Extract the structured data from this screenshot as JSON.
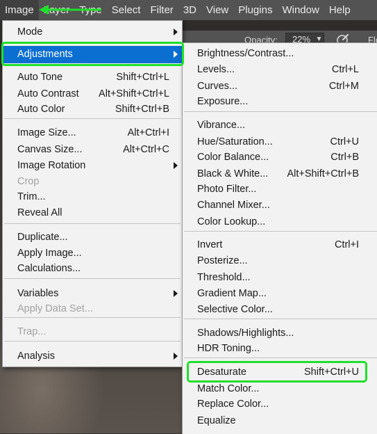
{
  "menubar": {
    "items": [
      "Image",
      "Layer",
      "Type",
      "Select",
      "Filter",
      "3D",
      "View",
      "Plugins",
      "Window",
      "Help"
    ],
    "active_index": 0
  },
  "options_bar": {
    "opacity_label": "Opacity:",
    "opacity_value": "22%",
    "flow_label": "Flo"
  },
  "image_menu": {
    "items": [
      {
        "label": "Mode",
        "shortcut": "",
        "submenu": true,
        "disabled": false
      },
      {
        "label": "Adjustments",
        "shortcut": "",
        "submenu": true,
        "disabled": false,
        "selected": true
      },
      {
        "label": "Auto Tone",
        "shortcut": "Shift+Ctrl+L",
        "submenu": false,
        "disabled": false
      },
      {
        "label": "Auto Contrast",
        "shortcut": "Alt+Shift+Ctrl+L",
        "submenu": false,
        "disabled": false
      },
      {
        "label": "Auto Color",
        "shortcut": "Shift+Ctrl+B",
        "submenu": false,
        "disabled": false
      },
      {
        "label": "Image Size...",
        "shortcut": "Alt+Ctrl+I",
        "submenu": false,
        "disabled": false
      },
      {
        "label": "Canvas Size...",
        "shortcut": "Alt+Ctrl+C",
        "submenu": false,
        "disabled": false
      },
      {
        "label": "Image Rotation",
        "shortcut": "",
        "submenu": true,
        "disabled": false
      },
      {
        "label": "Crop",
        "shortcut": "",
        "submenu": false,
        "disabled": true
      },
      {
        "label": "Trim...",
        "shortcut": "",
        "submenu": false,
        "disabled": false
      },
      {
        "label": "Reveal All",
        "shortcut": "",
        "submenu": false,
        "disabled": false
      },
      {
        "label": "Duplicate...",
        "shortcut": "",
        "submenu": false,
        "disabled": false
      },
      {
        "label": "Apply Image...",
        "shortcut": "",
        "submenu": false,
        "disabled": false
      },
      {
        "label": "Calculations...",
        "shortcut": "",
        "submenu": false,
        "disabled": false
      },
      {
        "label": "Variables",
        "shortcut": "",
        "submenu": true,
        "disabled": false
      },
      {
        "label": "Apply Data Set...",
        "shortcut": "",
        "submenu": false,
        "disabled": true
      },
      {
        "label": "Trap...",
        "shortcut": "",
        "submenu": false,
        "disabled": true
      },
      {
        "label": "Analysis",
        "shortcut": "",
        "submenu": true,
        "disabled": false
      }
    ]
  },
  "adjustments_menu": {
    "items": [
      {
        "label": "Brightness/Contrast...",
        "shortcut": ""
      },
      {
        "label": "Levels...",
        "shortcut": "Ctrl+L"
      },
      {
        "label": "Curves...",
        "shortcut": "Ctrl+M"
      },
      {
        "label": "Exposure...",
        "shortcut": ""
      },
      {
        "label": "Vibrance...",
        "shortcut": ""
      },
      {
        "label": "Hue/Saturation...",
        "shortcut": "Ctrl+U"
      },
      {
        "label": "Color Balance...",
        "shortcut": "Ctrl+B"
      },
      {
        "label": "Black & White...",
        "shortcut": "Alt+Shift+Ctrl+B"
      },
      {
        "label": "Photo Filter...",
        "shortcut": ""
      },
      {
        "label": "Channel Mixer...",
        "shortcut": ""
      },
      {
        "label": "Color Lookup...",
        "shortcut": ""
      },
      {
        "label": "Invert",
        "shortcut": "Ctrl+I"
      },
      {
        "label": "Posterize...",
        "shortcut": ""
      },
      {
        "label": "Threshold...",
        "shortcut": ""
      },
      {
        "label": "Gradient Map...",
        "shortcut": ""
      },
      {
        "label": "Selective Color...",
        "shortcut": ""
      },
      {
        "label": "Shadows/Highlights...",
        "shortcut": ""
      },
      {
        "label": "HDR Toning...",
        "shortcut": ""
      },
      {
        "label": "Desaturate",
        "shortcut": "Shift+Ctrl+U",
        "highlighted": true
      },
      {
        "label": "Match Color...",
        "shortcut": ""
      },
      {
        "label": "Replace Color...",
        "shortcut": ""
      },
      {
        "label": "Equalize",
        "shortcut": ""
      }
    ]
  },
  "colors": {
    "menu_bg": "#f2f2f2",
    "menubar_bg": "#535353",
    "selection_blue": "#0b6ed1",
    "annotation_green": "#1fe02a"
  }
}
